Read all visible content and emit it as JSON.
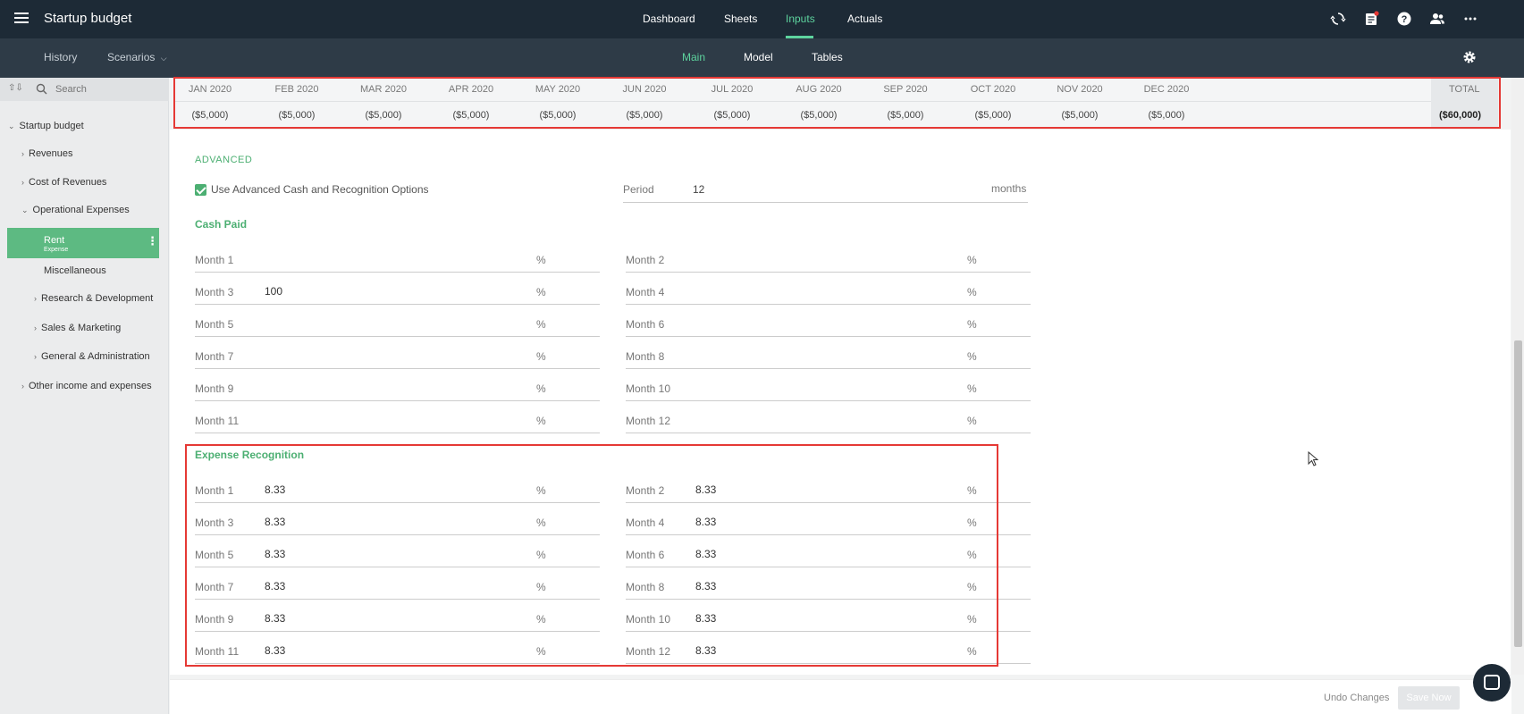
{
  "app": {
    "title": "Startup budget"
  },
  "topnav": {
    "items": [
      "Dashboard",
      "Sheets",
      "Inputs",
      "Actuals"
    ],
    "active": "Inputs"
  },
  "subbar": {
    "left": [
      "History",
      "Scenarios"
    ],
    "tabs": [
      "Main",
      "Model",
      "Tables"
    ],
    "active_tab": "Main"
  },
  "sidebar": {
    "search_placeholder": "Search",
    "tree": [
      {
        "label": "Startup budget"
      },
      {
        "label": "Revenues"
      },
      {
        "label": "Cost of Revenues"
      },
      {
        "label": "Operational Expenses"
      },
      {
        "label": "Rent",
        "sub": "Expense"
      },
      {
        "label": "Miscellaneous"
      },
      {
        "label": "Research & Development"
      },
      {
        "label": "Sales & Marketing"
      },
      {
        "label": "General & Administration"
      },
      {
        "label": "Other income and expenses"
      }
    ]
  },
  "timeline": {
    "months": [
      "JAN 2020",
      "FEB 2020",
      "MAR 2020",
      "APR 2020",
      "MAY 2020",
      "JUN 2020",
      "JUL 2020",
      "AUG 2020",
      "SEP 2020",
      "OCT 2020",
      "NOV 2020",
      "DEC 2020"
    ],
    "values": [
      "($5,000)",
      "($5,000)",
      "($5,000)",
      "($5,000)",
      "($5,000)",
      "($5,000)",
      "($5,000)",
      "($5,000)",
      "($5,000)",
      "($5,000)",
      "($5,000)",
      "($5,000)"
    ],
    "total_label": "TOTAL",
    "total_value": "($60,000)"
  },
  "advanced": {
    "section_label": "ADVANCED",
    "checkbox_label": "Use Advanced Cash and Recognition Options",
    "checked": true,
    "period_label": "Period",
    "period_value": "12",
    "period_unit": "months"
  },
  "cash_paid": {
    "title": "Cash Paid",
    "months": [
      {
        "label": "Month 1",
        "value": ""
      },
      {
        "label": "Month 2",
        "value": ""
      },
      {
        "label": "Month 3",
        "value": "100"
      },
      {
        "label": "Month 4",
        "value": ""
      },
      {
        "label": "Month 5",
        "value": ""
      },
      {
        "label": "Month 6",
        "value": ""
      },
      {
        "label": "Month 7",
        "value": ""
      },
      {
        "label": "Month 8",
        "value": ""
      },
      {
        "label": "Month 9",
        "value": ""
      },
      {
        "label": "Month 10",
        "value": ""
      },
      {
        "label": "Month 11",
        "value": ""
      },
      {
        "label": "Month 12",
        "value": ""
      }
    ]
  },
  "expense_recognition": {
    "title": "Expense Recognition",
    "months": [
      {
        "label": "Month 1",
        "value": "8.33"
      },
      {
        "label": "Month 2",
        "value": "8.33"
      },
      {
        "label": "Month 3",
        "value": "8.33"
      },
      {
        "label": "Month 4",
        "value": "8.33"
      },
      {
        "label": "Month 5",
        "value": "8.33"
      },
      {
        "label": "Month 6",
        "value": "8.33"
      },
      {
        "label": "Month 7",
        "value": "8.33"
      },
      {
        "label": "Month 8",
        "value": "8.33"
      },
      {
        "label": "Month 9",
        "value": "8.33"
      },
      {
        "label": "Month 10",
        "value": "8.33"
      },
      {
        "label": "Month 11",
        "value": "8.33"
      },
      {
        "label": "Month 12",
        "value": "8.33"
      }
    ]
  },
  "unit_symbol": "%",
  "footer": {
    "undo_label": "Undo Changes",
    "save_label": "Save Now"
  },
  "colors": {
    "accent": "#5dd39e",
    "highlight": "#e53935",
    "nav_bg": "#1d2a36"
  }
}
